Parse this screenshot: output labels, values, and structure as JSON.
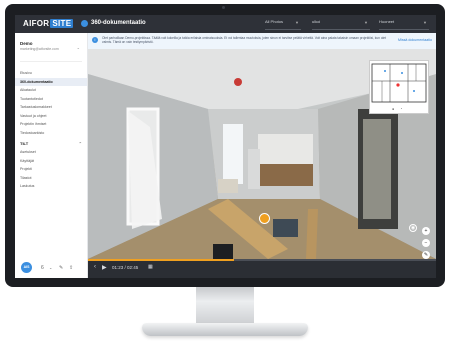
{
  "app": {
    "logo_left": "AIFOR",
    "logo_right": "SITE",
    "page_title": "360-dokumentaatio"
  },
  "header": {
    "select1": "All Photos",
    "select2": "ulkoi",
    "select3": "Huoneet"
  },
  "sidebar": {
    "user_name": "Demo",
    "user_email": "marketing@aiforsite.com",
    "items": [
      {
        "label": "Etusivu"
      },
      {
        "label": "360-dokumentaatio",
        "active": true
      },
      {
        "label": "Aikataulut"
      },
      {
        "label": "Tuotantotiedot"
      },
      {
        "label": "Tarkastuslomakkeet"
      },
      {
        "label": "Vastuut ja ohjeet"
      },
      {
        "label": "Projektin ihmiset"
      },
      {
        "label": "Tiedostoarkisto"
      }
    ],
    "section": "TILT",
    "section_items": [
      {
        "label": "Asetukset"
      },
      {
        "label": "Käyttäjät"
      },
      {
        "label": "Projekti"
      },
      {
        "label": "Tilastot"
      },
      {
        "label": "Laskutus"
      }
    ],
    "avatar_initials": "AIS",
    "footer_count": "6"
  },
  "notice": {
    "text": "Olet parhaillaan Demo-projektissa. Täällä voit kokeilla ja tutkia erilaisia ominaisuuksia. Et voi tallentaa muutoksia, joten sinun ei tarvitse pelätä virheitä. Voit aina palata takaisin omaan projektiisi, kun olet valmis. Tämä on vain testiympäristö.",
    "link": "Missä dokumentaatio"
  },
  "player": {
    "time": "01:23 / 02:45",
    "progress_fraction": 0.42
  },
  "colors": {
    "accent": "#3b8fe0",
    "topbar": "#2e3138",
    "highlight": "#f0a020"
  }
}
